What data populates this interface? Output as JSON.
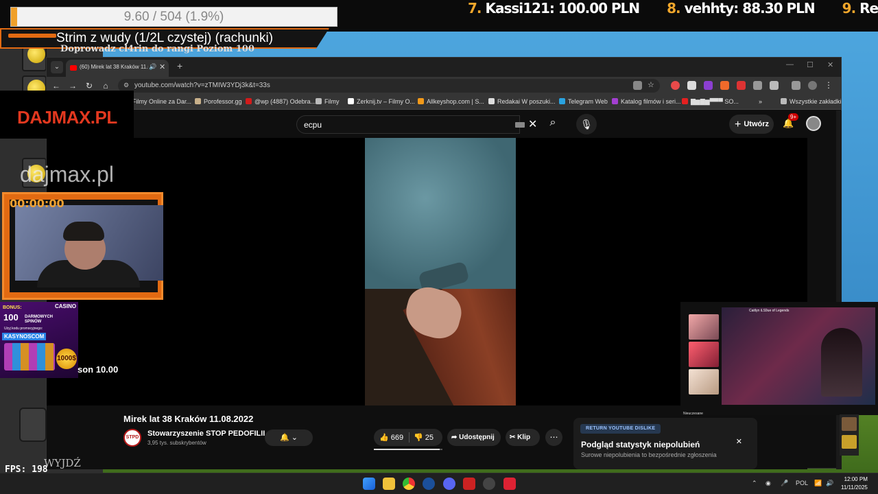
{
  "stream": {
    "donation_goal": "9.60 / 504 (1.9%)",
    "donation_progress_pct": 1.9,
    "title": "Strim z wudy (1/2L czystej) (rachunki)",
    "quest_text": "Doprowadz cl4rin do rangi Poziom 100",
    "leaderboard": [
      {
        "rank": "7.",
        "name": "Kassi121:",
        "amount": "100.00 PLN"
      },
      {
        "rank": "8.",
        "name": "vehhty:",
        "amount": "88.30 PLN"
      },
      {
        "rank": "9.",
        "name": "Recesy",
        "amount": ""
      }
    ],
    "brand": "DAJMAX.PL",
    "brand_watermark": "dajmax.pl",
    "timer": "00:00:00",
    "casino": {
      "label": "CASINO",
      "bonus": "BONUS:",
      "headline": "100",
      "spins_line1": "DARMOWYCH",
      "spins_line2": "SPINÓW",
      "promo_note": "Użyj kodu promocyjnego:",
      "code": "KASYNOSCOM",
      "badge": "1000$"
    },
    "game_score": "son 10.00",
    "exit_label": "WYJDŹ",
    "fps": "FPS: 198"
  },
  "browser": {
    "tab_title": "(60) Mirek lat 38 Kraków 11.08.2022",
    "url": "youtube.com/watch?v=zTMIW3YDj3k&t=33s",
    "bookmarks": [
      {
        "label": "Filmy Online za Dar...",
        "color": "#3b6fd1"
      },
      {
        "label": "Porofessor.gg",
        "color": "#c8b08a"
      },
      {
        "label": "@wp (4887) Odebra...",
        "color": "#d21b1b"
      },
      {
        "label": "Filmy",
        "color": "#bbbbbb"
      },
      {
        "label": "Zerknij.tv – Filmy O...",
        "color": "#ffffff"
      },
      {
        "label": "Allkeyshop.com | S...",
        "color": "#f39a1a"
      },
      {
        "label": "Redakai W poszuki...",
        "color": "#dddddd"
      },
      {
        "label": "Telegram Web",
        "color": "#2aa3e0"
      },
      {
        "label": "Katalog filmów i seri...",
        "color": "#a33fd1"
      },
      {
        "label": "SO...",
        "color": "#e52020"
      }
    ],
    "all_bookmarks": "Wszystkie zakładki"
  },
  "youtube": {
    "search_query": "ecpu",
    "create_label": "Utwórz",
    "notifications": "9+",
    "video_title": "Mirek lat 38 Kraków 11.08.2022",
    "channel_logo": "STPD",
    "channel_name": "Stowarzyszenie STOP PEDOFILII",
    "subscribers": "3,95 tys. subskrybentów",
    "likes": "669",
    "dislikes": "25",
    "like_ratio": 0.964,
    "share_label": "Udostępnij",
    "clip_label": "Klip",
    "ryd": {
      "tag": "RETURN YOUTUBE DISLIKE",
      "title": "Podgląd statystyk niepolubień",
      "subtitle": "Surowe niepolubienia to bezpośrednie zgłoszenia"
    }
  },
  "pip": {
    "topline": "Caitlyn iLS9ue of Legends",
    "chat_name": "Nieuczesane"
  },
  "taskbar": {
    "language": "POL",
    "time": "12:00 PM",
    "date": "11/11/2025"
  }
}
